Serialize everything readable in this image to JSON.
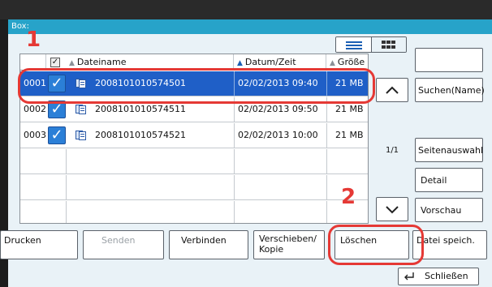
{
  "title": "Box:",
  "badges": {
    "one": "1",
    "two": "2"
  },
  "columns": {
    "name": "Dateiname",
    "datetime": "Datum/Zeit",
    "size": "Größe"
  },
  "rows": [
    {
      "num": "0001",
      "name": "2008101010574501",
      "date": "02/02/2013 09:40",
      "size": "21 MB",
      "selected": true
    },
    {
      "num": "0002",
      "name": "2008101010574511",
      "date": "02/02/2013 09:50",
      "size": "21 MB",
      "selected": false
    },
    {
      "num": "0003",
      "name": "2008101010574521",
      "date": "02/02/2013 10:00",
      "size": "21 MB",
      "selected": false
    }
  ],
  "page_indicator": "1/1",
  "side": {
    "search": "Suchen(Name)",
    "page_select": "Seitenauswahl",
    "detail": "Detail",
    "preview": "Vorschau",
    "save_file": "Datei speich."
  },
  "actions": {
    "print": "Drucken",
    "send": "Senden",
    "join": "Verbinden",
    "move_copy_1": "Verschieben/",
    "move_copy_2": "Kopie",
    "delete": "Löschen"
  },
  "close": "Schließen",
  "icons": [
    "list-view-icon",
    "thumbnail-view-icon",
    "checkmark-icon",
    "file-icon",
    "sort-triangle-icon",
    "arrow-up-icon",
    "arrow-down-icon",
    "return-arrow-icon"
  ],
  "colors": {
    "title_bar": "#27a3c9",
    "selected_row": "#1f5fc7",
    "highlight": "#e53935",
    "panel": "#e9f2f7"
  }
}
